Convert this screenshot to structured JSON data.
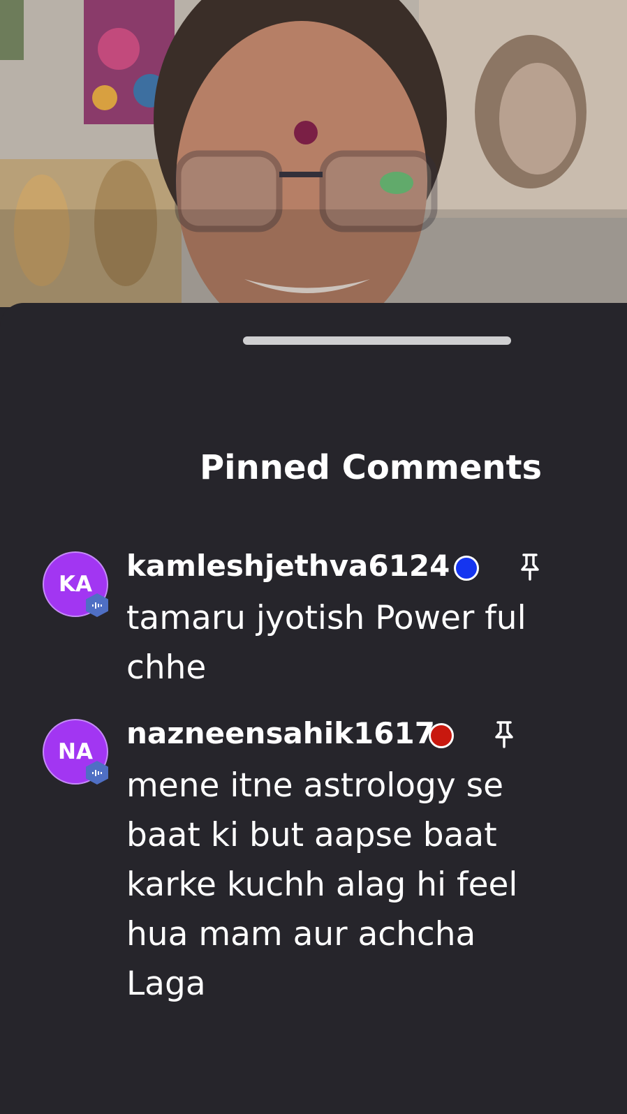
{
  "video": {
    "label": "live-video-stream"
  },
  "sheet": {
    "title": "Pinned Comments"
  },
  "comments": [
    {
      "initials": "KA",
      "username": "kamleshjethva6124",
      "status_color": "#1535f0",
      "text": "tamaru jyotish Power ful chhe",
      "icon": "pin-icon"
    },
    {
      "initials": "NA",
      "username": "nazneensahik1617",
      "status_color": "#c8180e",
      "text": "mene itne astrology se baat ki but aapse baat karke kuchh alag hi feel hua mam aur achcha Laga",
      "icon": "pin-icon"
    }
  ],
  "colors": {
    "sheet_bg": "#26252b",
    "avatar_bg": "#a236f2",
    "badge_bg": "#4f6fc4",
    "handle": "#cfcfd1"
  }
}
